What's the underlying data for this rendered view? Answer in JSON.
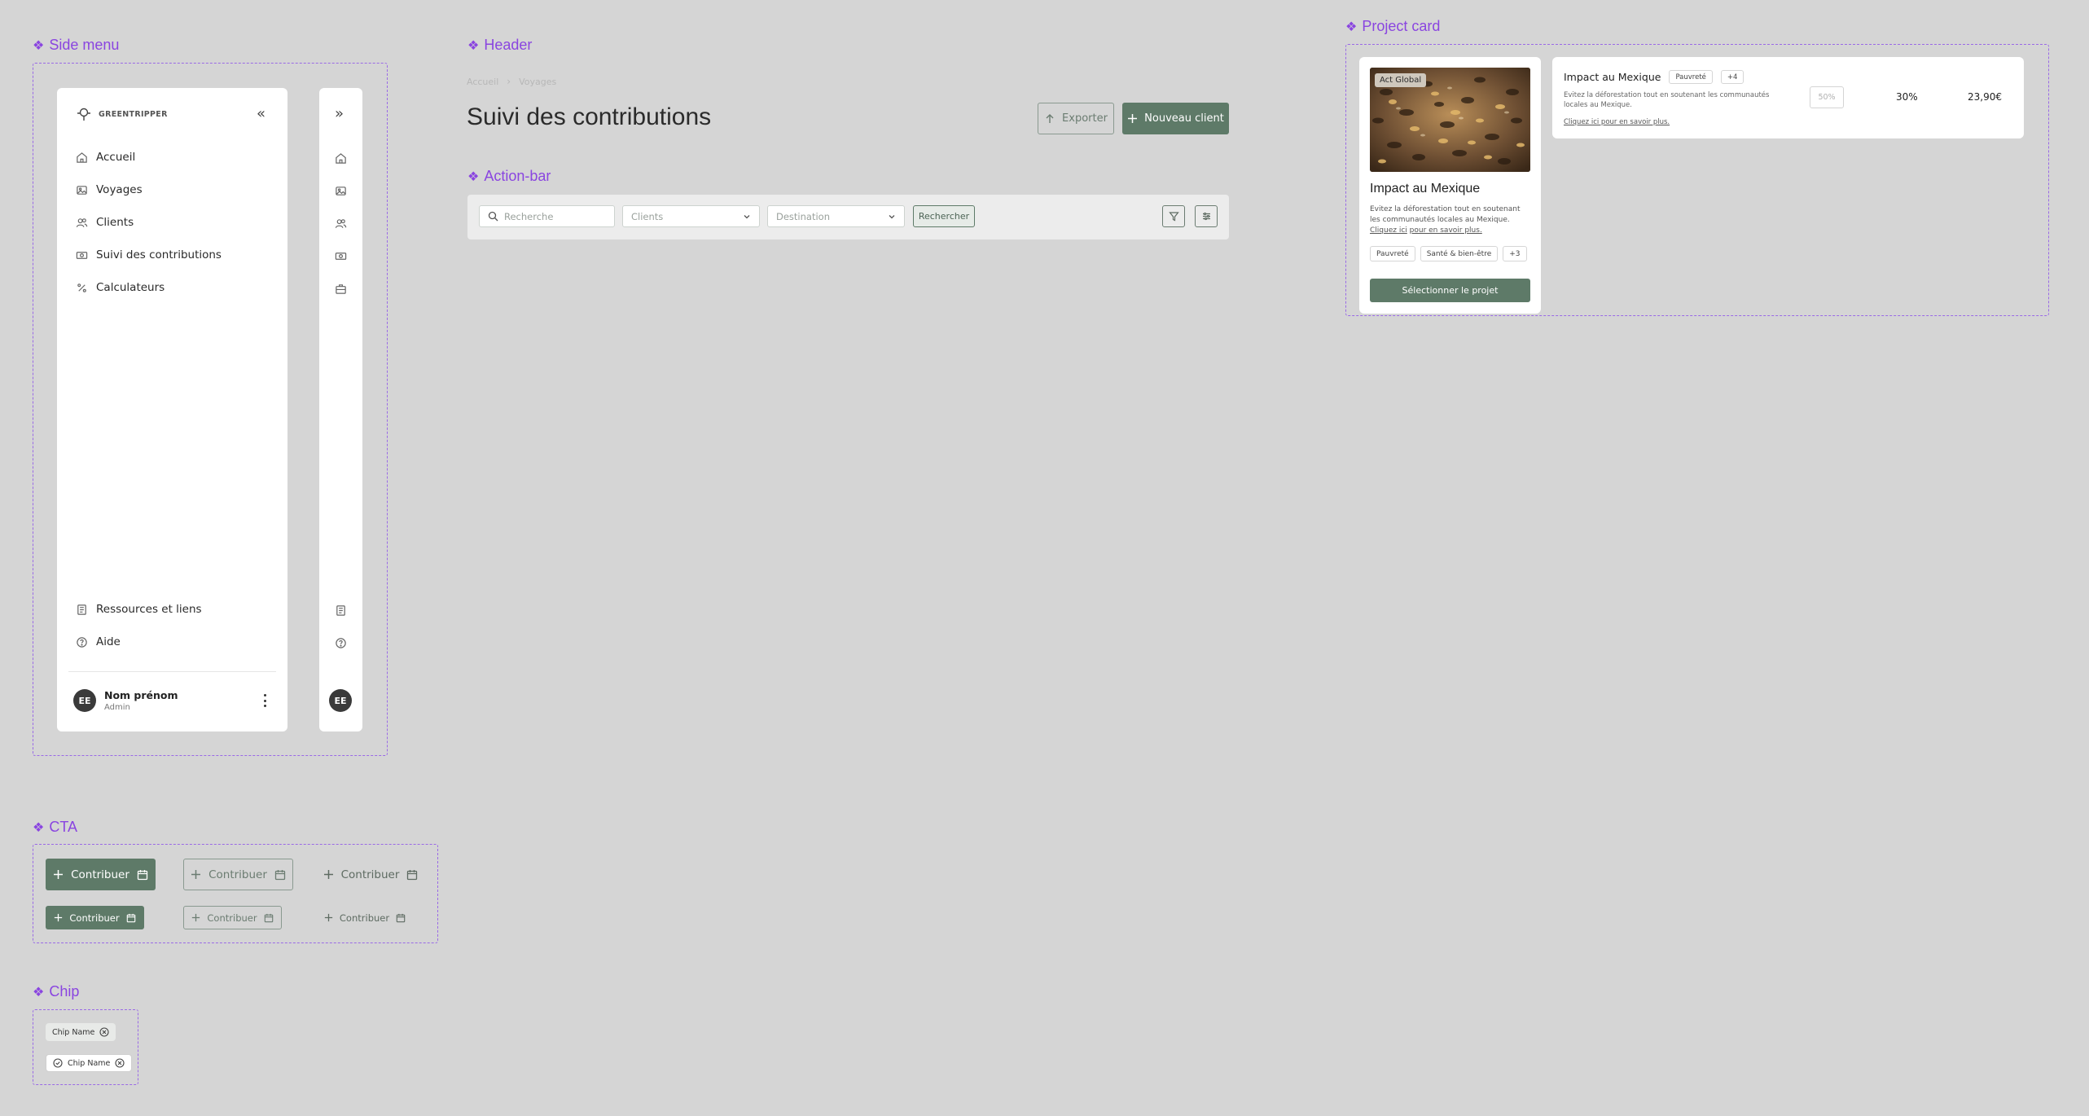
{
  "sections": {
    "side_menu": "Side menu",
    "header": "Header",
    "action_bar": "Action-bar",
    "project_card": "Project card",
    "cta": "CTA",
    "chip": "Chip"
  },
  "sidebar": {
    "brand": "GREENTRIPPER",
    "collapse_glyph": "«",
    "expand_glyph": "»",
    "items": [
      {
        "label": "Accueil",
        "icon": "home-icon"
      },
      {
        "label": "Voyages",
        "icon": "image-icon"
      },
      {
        "label": "Clients",
        "icon": "users-icon"
      },
      {
        "label": "Suivi des contributions",
        "icon": "banknote-icon"
      },
      {
        "label": "Calculateurs",
        "icon": "percent-icon"
      }
    ],
    "bottom_items": [
      {
        "label": "Ressources et liens",
        "icon": "book-icon"
      },
      {
        "label": "Aide",
        "icon": "help-icon"
      }
    ],
    "collapsed_extra_icon": "briefcase-icon",
    "user": {
      "initials": "EE",
      "name": "Nom prénom",
      "role": "Admin"
    }
  },
  "header": {
    "breadcrumb": [
      "Accueil",
      "Voyages"
    ],
    "title": "Suivi des contributions",
    "export_label": "Exporter",
    "new_client_label": "Nouveau client"
  },
  "action_bar": {
    "search_placeholder": "Recherche",
    "clients_placeholder": "Clients",
    "destination_placeholder": "Destination",
    "search_button": "Rechercher"
  },
  "project_card": {
    "badge": "Act Global",
    "title": "Impact au Mexique",
    "desc": "Evitez la déforestation tout en soutenant les communautés locales au Mexique.",
    "link": "Cliquez ici",
    "link_tail": "pour en savoir plus.",
    "tags": [
      "Pauvreté",
      "Santé & bien-être",
      "+3"
    ],
    "cta": "Sélectionner le projet"
  },
  "project_row": {
    "title": "Impact au Mexique",
    "tags": [
      "Pauvreté",
      "+4"
    ],
    "desc": "Evitez la déforestation tout en soutenant les communautés locales au Mexique.",
    "link": "Cliquez ici pour en savoir plus.",
    "input_placeholder": "50%",
    "percent": "30%",
    "amount": "23,90€"
  },
  "cta": {
    "label": "Contribuer"
  },
  "chips": {
    "label": "Chip Name"
  },
  "colors": {
    "primary": "#5e7a68",
    "accent": "#8a45e0",
    "background": "#d5d5d5"
  }
}
